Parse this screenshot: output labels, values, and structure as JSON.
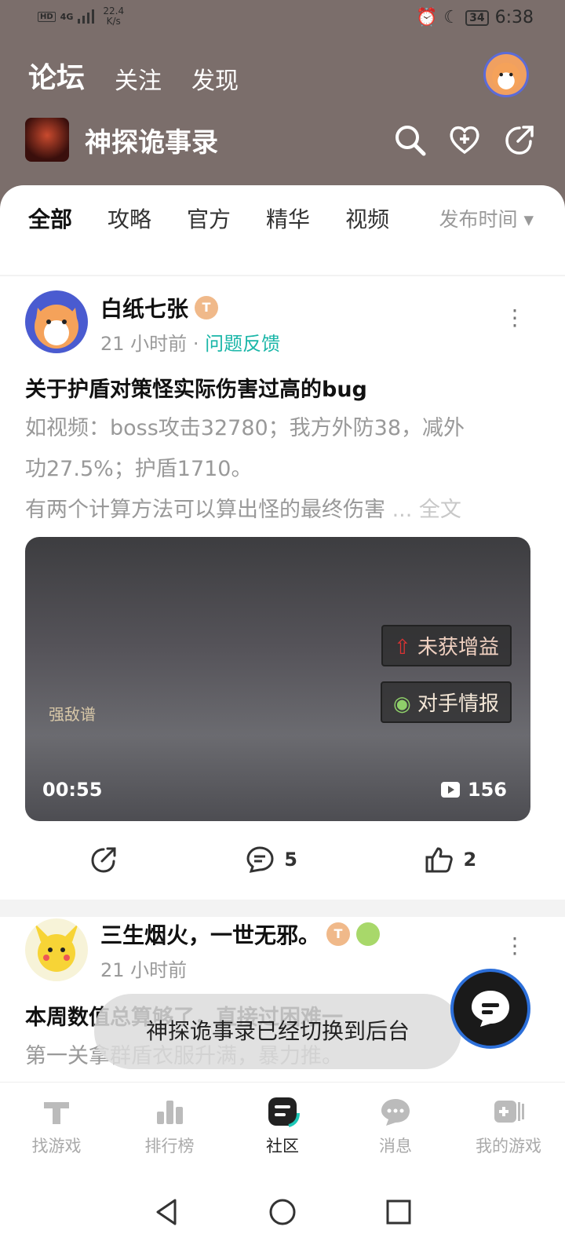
{
  "status_bar": {
    "network": "HD",
    "signal": "4G",
    "speed_value": "22.4",
    "speed_unit": "K/s",
    "battery": "34",
    "time": "6:38"
  },
  "header": {
    "tabs": [
      "论坛",
      "关注",
      "发现"
    ],
    "game_title": "神探诡事录"
  },
  "filters": {
    "tabs": [
      "全部",
      "攻略",
      "官方",
      "精华",
      "视频"
    ],
    "sort_label": "发布时间 ▾"
  },
  "posts": [
    {
      "username": "白纸七张",
      "badge": "T",
      "time": "21 小时前",
      "tag": "问题反馈",
      "title": "关于护盾对策怪实际伤害过高的bug",
      "body_line1": "如视频：boss攻击32780；我方外防38，减外",
      "body_line2": "功27.5%；护盾1710。",
      "body_line3": "有两个计算方法可以算出怪的最终伤害",
      "read_more": "... 全文",
      "video": {
        "duration": "00:55",
        "views": "156",
        "tag1": "未获增益",
        "tag2": "对手情报",
        "tag3": "强敌谱"
      },
      "comments": "5",
      "likes": "2"
    },
    {
      "username": "三生烟火，一世无邪。",
      "badge": "T",
      "time": "21 小时前",
      "title": "本周数值总算够了，直接过困难一",
      "body_line1": "第一关拿群盾衣服升满，暴力推。"
    }
  ],
  "toast": "神探诡事录已经切换到后台",
  "bottom_tabs": [
    "找游戏",
    "排行榜",
    "社区",
    "消息",
    "我的游戏"
  ]
}
